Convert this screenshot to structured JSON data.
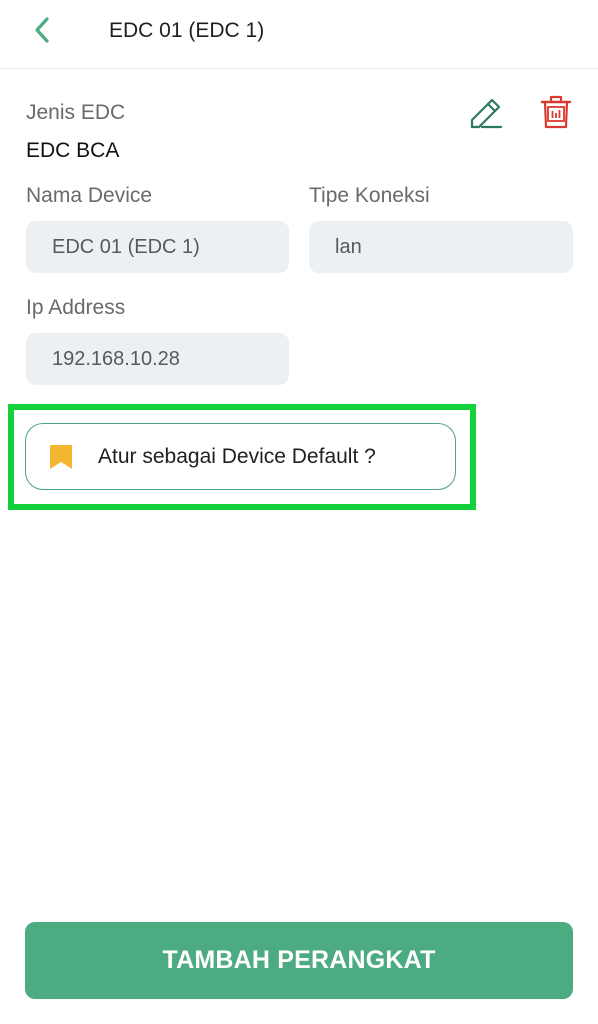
{
  "header": {
    "title": "EDC 01 (EDC 1)",
    "back_icon": "chevron-left-icon"
  },
  "actions": {
    "edit_icon": "edit-pencil-icon",
    "delete_icon": "trash-icon"
  },
  "detail": {
    "jenis_label": "Jenis EDC",
    "jenis_value": "EDC BCA",
    "nama_label": "Nama Device",
    "nama_value": "EDC 01 (EDC 1)",
    "tipe_label": "Tipe Koneksi",
    "tipe_value": "lan",
    "ip_label": "Ip Address",
    "ip_value": "192.168.10.28"
  },
  "default_button": {
    "label": "Atur sebagai Device Default ?",
    "icon": "bookmark-icon"
  },
  "primary_button": {
    "label": "TAMBAH PERANGKAT"
  },
  "colors": {
    "accent": "#4cab80",
    "delete": "#d83a2f",
    "bookmark": "#f5b731",
    "highlight": "#12d13a",
    "field_bg": "#edf0f3"
  }
}
